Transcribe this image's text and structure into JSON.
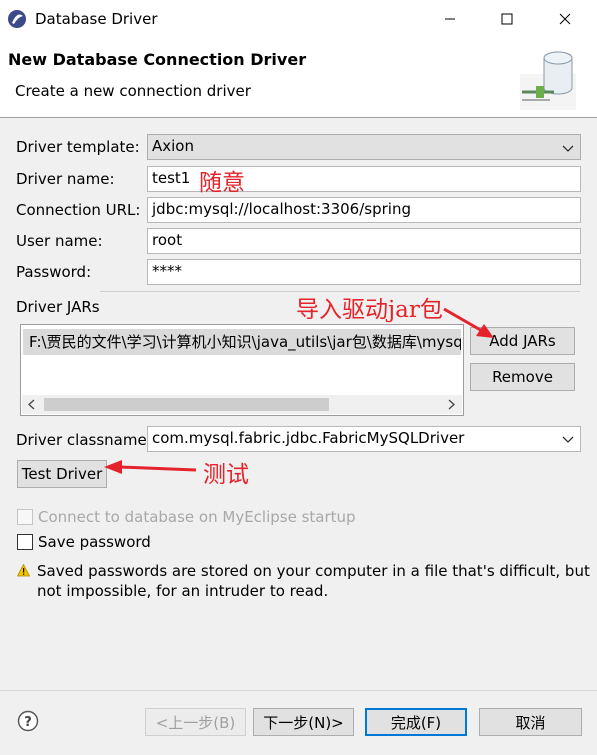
{
  "window": {
    "title": "Database Driver"
  },
  "header": {
    "title": "New Database Connection Driver",
    "subtitle": "Create a new connection driver"
  },
  "form": {
    "template_label": "Driver template:",
    "template_value": "Axion",
    "name_label": "Driver name:",
    "name_value": "test1",
    "url_label": "Connection URL:",
    "url_value": "jdbc:mysql://localhost:3306/spring",
    "user_label": "User name:",
    "user_value": "root",
    "password_label": "Password:",
    "password_value": "****"
  },
  "jars": {
    "label": "Driver JARs",
    "items": [
      "F:\\贾民的文件\\学习\\计算机小知识\\java_utils\\jar包\\数据库\\mysql"
    ],
    "add_label": "Add JARs",
    "remove_label": "Remove"
  },
  "classname": {
    "label": "Driver classname:",
    "value": "com.mysql.fabric.jdbc.FabricMySQLDriver"
  },
  "test_label": "Test Driver",
  "options": {
    "connect_startup": "Connect to database on MyEclipse startup",
    "save_password": "Save password",
    "warning_line1": "Saved passwords are stored on your computer in a file that's difficult, but",
    "warning_line2": "not impossible, for an intruder to read."
  },
  "annotations": {
    "name_note": "随意",
    "jar_note": "导入驱动jar包",
    "test_note": "测试"
  },
  "footer": {
    "back": "<上一步(B)",
    "next": "下一步(N)>",
    "finish": "完成(F)",
    "cancel": "取消"
  },
  "colors": {
    "accent": "#0078d7",
    "annotation": "#e5232a",
    "warning": "#f2c200"
  },
  "icons": [
    "app-icon",
    "minimize-icon",
    "maximize-icon",
    "close-icon",
    "database-banner-icon",
    "chevron-down-icon",
    "warning-icon",
    "help-icon",
    "arrow-annotation-icon"
  ]
}
